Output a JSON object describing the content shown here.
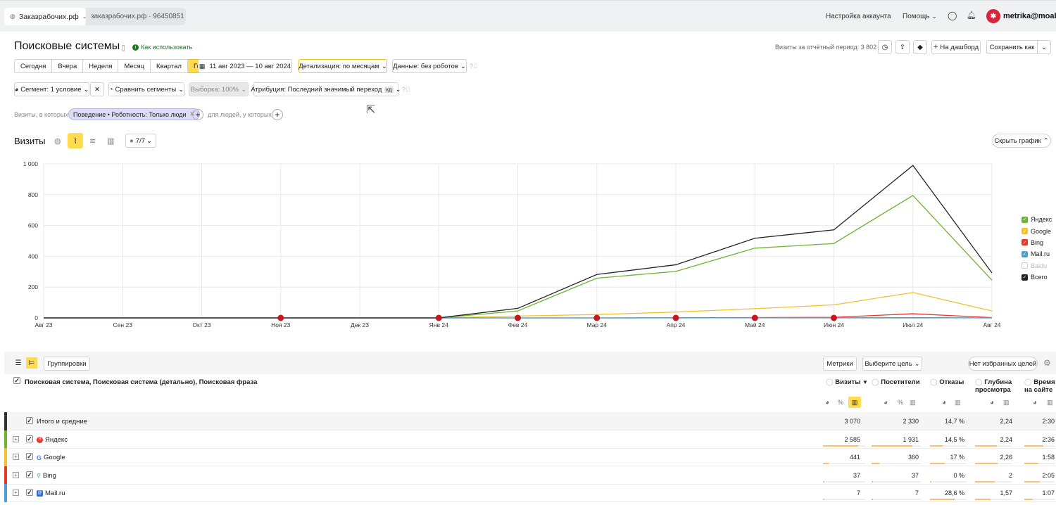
{
  "topbar": {
    "site_tab": "Заказрабочих.рф",
    "counter_tab": "заказрабочих.рф · 96450851",
    "account_settings": "Настройка аккаунта",
    "help": "Помощь",
    "user": "metrika@moab.pro"
  },
  "header": {
    "title": "Поисковые системы",
    "how_to_use": "Как использовать",
    "visits_period": "Визиты за отчётный период: 3 802",
    "to_dashboard": "На дашборд",
    "save_as": "Сохранить как"
  },
  "periods": [
    "Сегодня",
    "Вчера",
    "Неделя",
    "Месяц",
    "Квартал",
    "Год"
  ],
  "active_period": "Год",
  "date_range": "11 авг 2023 — 10 авг 2024",
  "detail": "Детализация: по месяцам",
  "data_filter": "Данные: без роботов",
  "segment": "Сегмент: 1 условие",
  "compare_segments": "Сравнить сегменты",
  "sample": "Выборка: 100%",
  "attribution": "Атрибуция: Последний значимый переход",
  "attribution_badge": "кд",
  "filter": {
    "visits_where": "Визиты, в которых",
    "chip": "Поведение • Роботность: Только люди",
    "for_people": "для людей, у которых"
  },
  "chart_header": {
    "title": "Визиты",
    "annotations": "7/7",
    "hide": "Скрыть график"
  },
  "chart_data": {
    "type": "line",
    "x": [
      "Авг 23",
      "Сен 23",
      "Окт 23",
      "Ноя 23",
      "Дек 23",
      "Янв 24",
      "Фев 24",
      "Мар 24",
      "Апр 24",
      "Май 24",
      "Июн 24",
      "Июл 24",
      "Авг 24"
    ],
    "ylim": [
      0,
      1000
    ],
    "yticks": [
      0,
      200,
      400,
      600,
      800,
      1000
    ],
    "ytick_labels": [
      "0",
      "200",
      "400",
      "600",
      "800",
      "1 000"
    ],
    "series": [
      {
        "name": "Яндекс",
        "color": "#6bb532",
        "values": [
          0,
          0,
          0,
          0,
          0,
          0,
          45,
          258,
          302,
          453,
          483,
          795,
          245
        ]
      },
      {
        "name": "Google",
        "color": "#f2c12e",
        "values": [
          0,
          0,
          0,
          0,
          0,
          0,
          12,
          22,
          38,
          60,
          85,
          165,
          45
        ]
      },
      {
        "name": "Bing",
        "color": "#e8362b",
        "values": [
          0,
          0,
          0,
          0,
          0,
          0,
          0,
          0,
          1,
          2,
          4,
          27,
          2
        ]
      },
      {
        "name": "Mail.ru",
        "color": "#4a9fd8",
        "values": [
          0,
          0,
          0,
          0,
          0,
          0,
          0,
          0,
          0,
          1,
          1,
          2,
          0
        ]
      },
      {
        "name": "Baidu",
        "color": "#cccccc",
        "values": [
          0,
          0,
          0,
          0,
          0,
          0,
          0,
          0,
          0,
          0,
          0,
          0,
          0
        ],
        "disabled": true
      },
      {
        "name": "Всего",
        "color": "#222222",
        "values": [
          0,
          0,
          0,
          0,
          0,
          0,
          62,
          282,
          345,
          517,
          572,
          990,
          292
        ]
      }
    ],
    "grid": true,
    "legend_position": "right"
  },
  "table": {
    "groupings": "Группировки",
    "metrics": "Метрики",
    "choose_goal": "Выберите цель",
    "no_goals": "Нет избранных целей",
    "dimension_header": "Поисковая система, Поисковая система (детально), Поисковая фраза",
    "columns": [
      "Визиты",
      "Посетители",
      "Отказы",
      "Глубина просмотра",
      "Время на сайте"
    ],
    "sort_mark": "▼",
    "pct": "%",
    "rows": [
      {
        "name": "Итого и средние",
        "values": [
          "3 070",
          "2 330",
          "14,7 %",
          "2,24",
          "2:30"
        ],
        "color": "#333333",
        "expandable": false
      },
      {
        "name": "Яндекс",
        "values": [
          "2 585",
          "1 931",
          "14,5 %",
          "2,24",
          "2:36"
        ],
        "color": "#6bb532",
        "expandable": true,
        "bars": [
          0.84,
          0.83,
          0.35,
          0.6,
          0.62
        ]
      },
      {
        "name": "Google",
        "values": [
          "441",
          "360",
          "17 %",
          "2,26",
          "1:58"
        ],
        "color": "#f2c12e",
        "expandable": true,
        "bars": [
          0.14,
          0.15,
          0.4,
          0.61,
          0.47
        ]
      },
      {
        "name": "Bing",
        "values": [
          "37",
          "37",
          "0 %",
          "2",
          "2:05"
        ],
        "color": "#e8362b",
        "expandable": true,
        "bars": [
          0.01,
          0.02,
          0,
          0.54,
          0.5
        ]
      },
      {
        "name": "Mail.ru",
        "values": [
          "7",
          "7",
          "28,6 %",
          "1,57",
          "1:07"
        ],
        "color": "#4a9fd8",
        "expandable": true,
        "bars": [
          0.003,
          0.003,
          0.68,
          0.42,
          0.27
        ]
      }
    ]
  }
}
